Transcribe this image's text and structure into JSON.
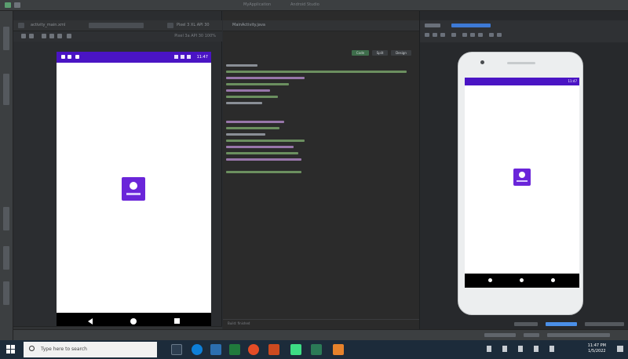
{
  "window": {
    "title_left": "MyApplication",
    "title_mid": "Android Studio"
  },
  "design": {
    "toolbar_left": "activity_main.xml",
    "toolbar_right": "Pixel 3 XL API 30",
    "sub_label": "Pixel 3a API 30  100%",
    "phone_time": "11:47"
  },
  "editor": {
    "tab": "MainActivity.java",
    "modes": [
      "Code",
      "Split",
      "Design"
    ],
    "status": "Build: finished"
  },
  "preview": {
    "phone_time": "11:47"
  },
  "taskbar": {
    "search_placeholder": "Type here to search",
    "time": "11:47 PM",
    "date": "1/5/2022"
  },
  "colors": {
    "accent": "#4a14c4",
    "logo": "#6a25d9",
    "ide_bg": "#2b2d30"
  }
}
